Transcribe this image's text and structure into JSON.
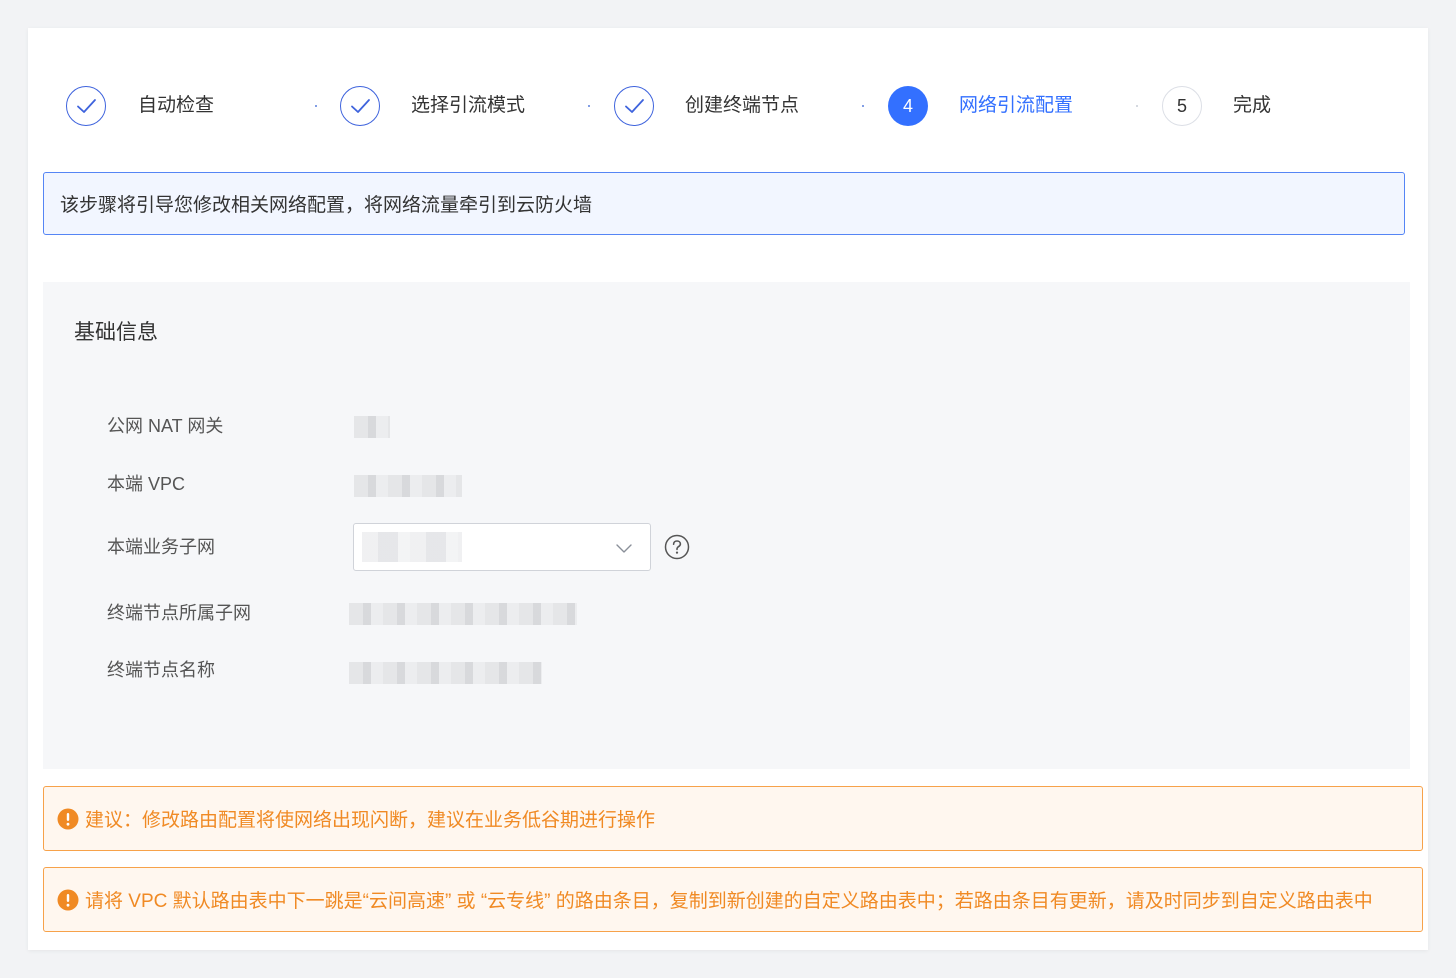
{
  "steps": [
    {
      "label": "自动检查",
      "state": "done"
    },
    {
      "label": "选择引流模式",
      "state": "done"
    },
    {
      "label": "创建终端节点",
      "state": "done"
    },
    {
      "label": "网络引流配置",
      "state": "active",
      "number": "4"
    },
    {
      "label": "完成",
      "state": "pending",
      "number": "5"
    }
  ],
  "info_banner": "该步骤将引导您修改相关网络配置，将网络流量牵引到云防火墙",
  "panel": {
    "title": "基础信息",
    "fields": [
      {
        "label": "公网 NAT 网关"
      },
      {
        "label": "本端 VPC"
      },
      {
        "label": "本端业务子网"
      },
      {
        "label": "终端节点所属子网"
      },
      {
        "label": "终端节点名称"
      }
    ]
  },
  "warnings": [
    "建议：修改路由配置将使网络出现闪断，建议在业务低谷期进行操作",
    "请将 VPC 默认路由表中下一跳是“云间高速” 或 “云专线” 的路由条目，复制到新创建的自定义路由表中；若路由条目有更新，请及时同步到自定义路由表中"
  ],
  "colors": {
    "primary": "#3370ff",
    "warning": "#f08a24",
    "info_border": "#5585f5"
  }
}
